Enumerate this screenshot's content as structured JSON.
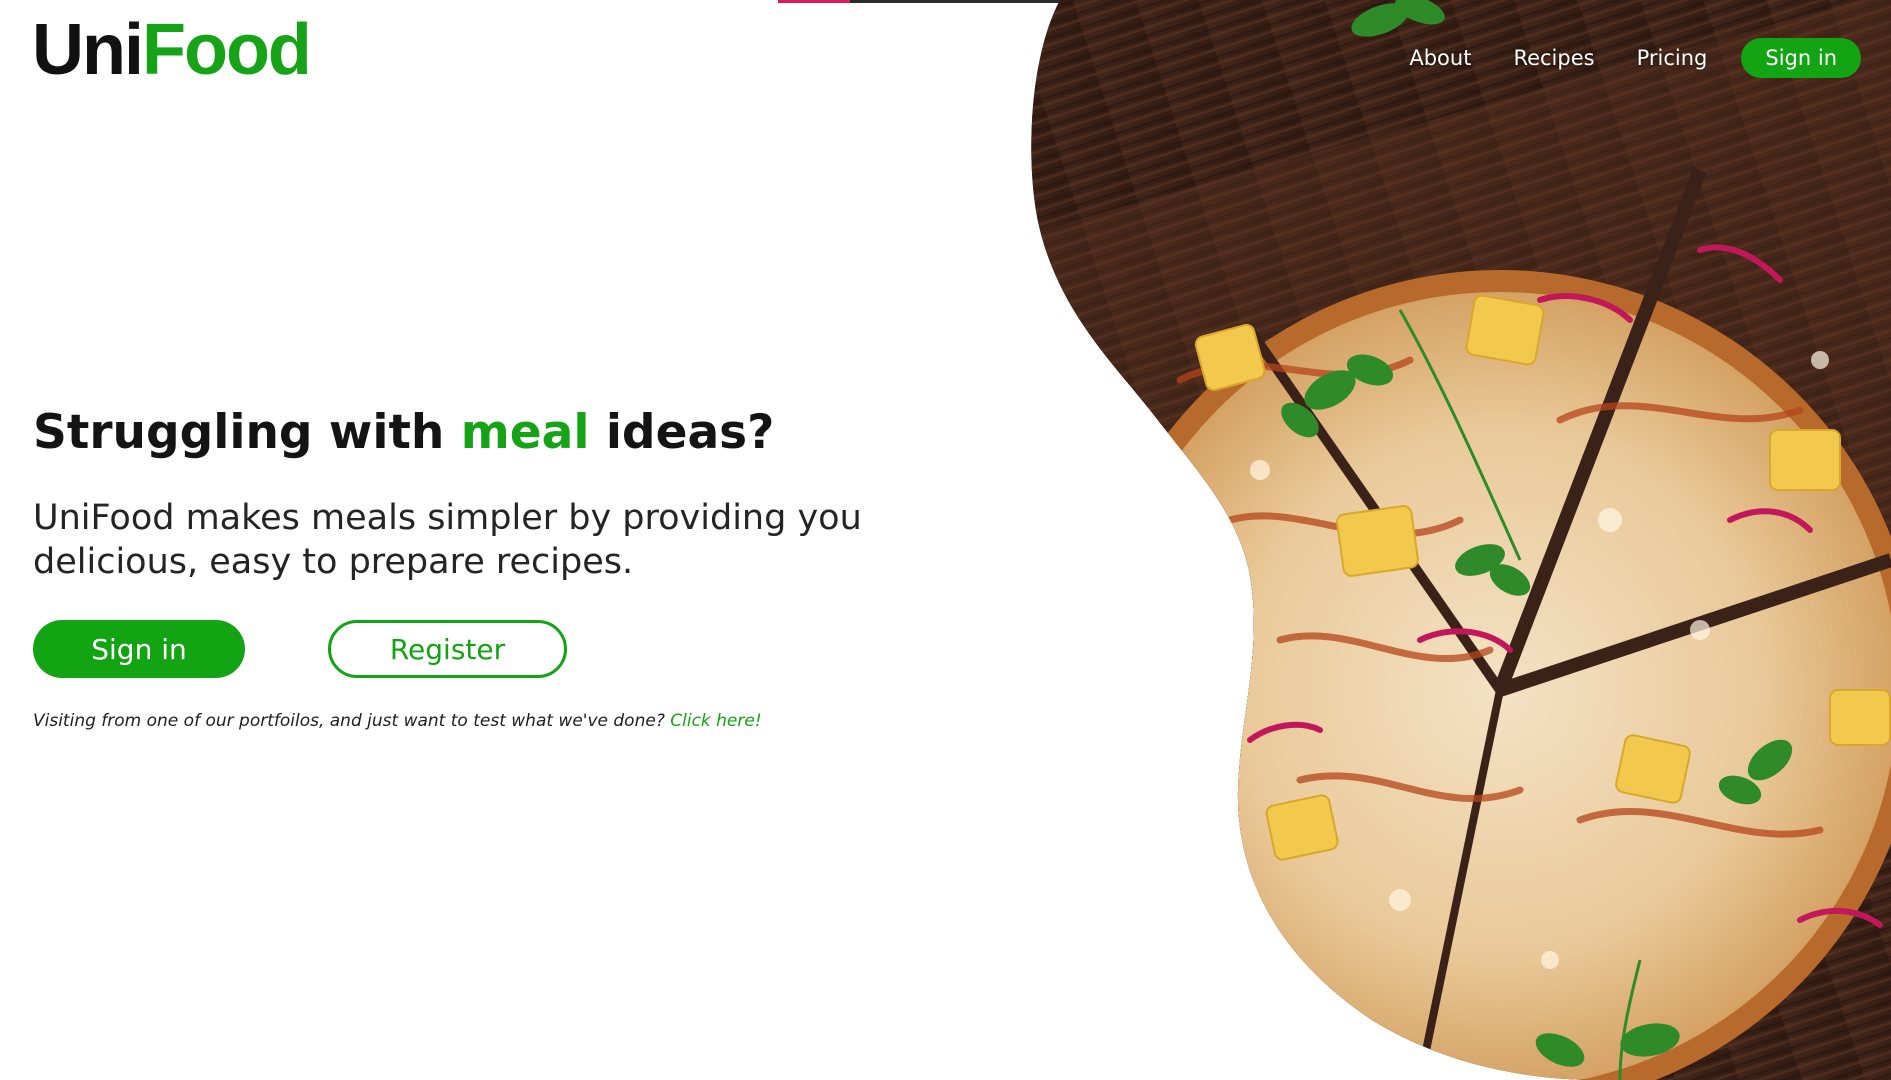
{
  "brand": {
    "name_part1": "Uni",
    "name_part2": "Food",
    "primary_color": "#13a413",
    "text_color": "#141414",
    "progress_accent": "#d81b60"
  },
  "nav": {
    "about": "About",
    "recipes": "Recipes",
    "pricing": "Pricing",
    "signin": "Sign in"
  },
  "hero": {
    "title_before": "Struggling with ",
    "title_accent": "meal",
    "title_after": " ideas?",
    "subtitle": "UniFood makes meals simpler by providing you delicious, easy to prepare recipes.",
    "signin_button": "Sign in",
    "register_button": "Register",
    "note_text": "Visiting from one of our portfoilos, and just want to test what we've done? ",
    "note_link": "Click here!",
    "image_icon": "pizza-photo"
  }
}
